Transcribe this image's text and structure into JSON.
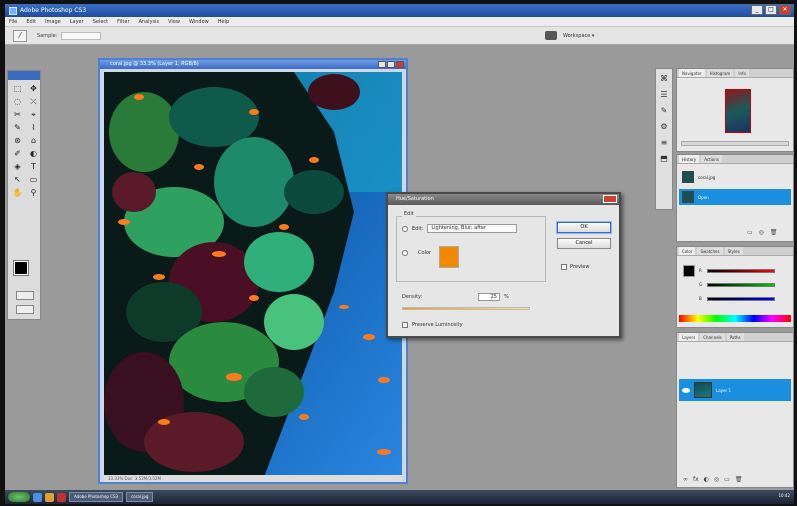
{
  "window": {
    "title": "Adobe Photoshop CS3",
    "buttons": [
      "_",
      "□",
      "✕"
    ]
  },
  "menu": [
    "File",
    "Edit",
    "Image",
    "Layer",
    "Select",
    "Filter",
    "Analysis",
    "View",
    "Window",
    "Help"
  ],
  "options_bar": {
    "tool_glyph": "⁄",
    "label": "Sample:",
    "workspace": "Workspace ▾"
  },
  "toolbox": {
    "tools": [
      "⬚",
      "✥",
      "◌",
      "⤫",
      "✂",
      "⌖",
      "✎",
      "⌇",
      "⊛",
      "⌂",
      "✐",
      "◐",
      "◈",
      "T",
      "↖",
      "▭",
      "✋",
      "⚲"
    ]
  },
  "document": {
    "title": "coral.jpg @ 33.3% (Layer 1, RGB/8)",
    "status": "33.33%   Doc: 3.52M/3.52M"
  },
  "dialog": {
    "title": "Hue/Saturation",
    "edit_legend": "Edit",
    "edit_label": "Edit:",
    "edit_value": "Lightening, Blur, after",
    "color_label": "Color",
    "slider_label": "Density:",
    "slider_value": "25",
    "slider_unit": "%",
    "preserve_label": "Preserve Luminosity",
    "ok_label": "OK",
    "cancel_label": "Cancel",
    "preview_label": "Preview",
    "color_hex": "#f28a00"
  },
  "panels": {
    "navigator_tabs": [
      "Navigator",
      "Histogram",
      "Info"
    ],
    "history_tabs": [
      "History",
      "Actions"
    ],
    "history_items": [
      "coral.jpg",
      "Open"
    ],
    "color_tabs": [
      "Color",
      "Swatches",
      "Styles"
    ],
    "color_channels": [
      "R",
      "G",
      "B"
    ],
    "layers_tabs": [
      "Layers",
      "Channels",
      "Paths"
    ],
    "layer_name": "Layer 1",
    "history_foot": [
      "▭",
      "◎",
      "🗑"
    ],
    "layer_tools": [
      "∞",
      "fx",
      "◐",
      "◎",
      "▭",
      "🗑"
    ]
  },
  "side_strip": [
    "⌘",
    "☰",
    "✎",
    "⚙",
    "≡",
    "⬒"
  ],
  "taskbar": {
    "items": [
      "Adobe Photoshop CS3",
      "coral.jpg"
    ],
    "tray": "10:42"
  }
}
